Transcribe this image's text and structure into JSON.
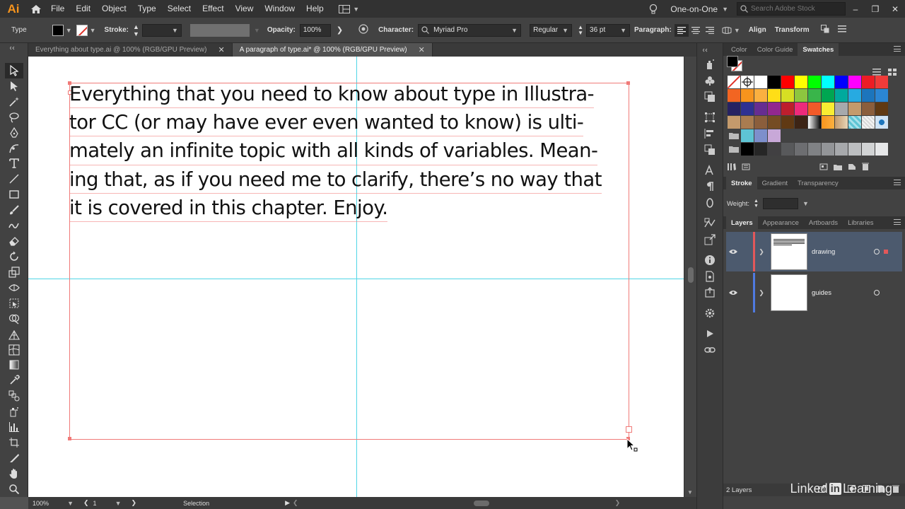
{
  "app": {
    "logo": "Ai",
    "menus": [
      "File",
      "Edit",
      "Object",
      "Type",
      "Select",
      "Effect",
      "View",
      "Window",
      "Help"
    ],
    "workspace": "One-on-One",
    "search_placeholder": "Search Adobe Stock"
  },
  "control_bar": {
    "tool_label": "Type",
    "stroke_label": "Stroke:",
    "opacity_label": "Opacity:",
    "opacity_value": "100%",
    "character_label": "Character:",
    "font_family": "Myriad Pro",
    "font_style": "Regular",
    "font_size": "36 pt",
    "paragraph_label": "Paragraph:",
    "align_link": "Align",
    "transform_link": "Transform"
  },
  "tabs": [
    {
      "label": "Everything about type.ai @ 100% (RGB/GPU Preview)",
      "active": false
    },
    {
      "label": "A paragraph of type.ai* @ 100% (RGB/GPU Preview)",
      "active": true
    }
  ],
  "canvas": {
    "lines": [
      "Everything that you need to know about type in Illustra-",
      "tor CC (or may have ever even wanted to know) is ulti-",
      "mately an infinite topic with all kinds of variables. Mean-",
      "ing that, as if you need me to clarify, there’s no way that",
      "it is covered in this chapter. Enjoy."
    ]
  },
  "status_bar": {
    "zoom": "100%",
    "artboard": "1",
    "tool": "Selection"
  },
  "panels": {
    "top_tabs": [
      "Color",
      "Color Guide",
      "Swatches"
    ],
    "active_top_tab": "Swatches",
    "stroke_tabs": [
      "Stroke",
      "Gradient",
      "Transparency"
    ],
    "weight_label": "Weight:",
    "layers_tabs": [
      "Layers",
      "Appearance",
      "Artboards",
      "Libraries"
    ],
    "layers": [
      {
        "name": "drawing",
        "color": "#e2585a",
        "selected": true
      },
      {
        "name": "guides",
        "color": "#4f7ae0",
        "selected": false
      }
    ],
    "layers_count": "2 Layers"
  },
  "swatches": {
    "rows": [
      [
        "none",
        "reg",
        "#ffffff",
        "#000000",
        "#ff0000",
        "#ffff00",
        "#00ff00",
        "#00ffff",
        "#0000ff",
        "#ff00ff",
        "#ed1c24",
        "#ef3b39"
      ],
      [
        "#f26522",
        "#f7941d",
        "#fbb040",
        "#ffde17",
        "#d7df23",
        "#8dc63f",
        "#39b54a",
        "#00a651",
        "#00a99d",
        "#27aae1",
        "#1c75bc",
        "#2b86d4"
      ],
      [
        "#262262",
        "#2e3192",
        "#662d91",
        "#92278f",
        "#be1e2d",
        "#ee2a7b",
        "#f15a29",
        "#f9ed32",
        "#a7a9ac",
        "#c49a6c",
        "#8b5e3c",
        "#603913"
      ],
      [
        "#c49a6c",
        "#a97c50",
        "#8b5e3c",
        "#754c24",
        "#603913",
        "#3c2415",
        "grad-bw",
        "grad-orange",
        "grad-tan",
        "pattern-blue",
        "pattern-white",
        "pattern-dots"
      ],
      [
        "folder",
        "#5ec4d4",
        "#7d8fcc",
        "#c8a8d8"
      ],
      [
        "folder",
        "#000000",
        "#262626",
        "#414042",
        "#58595b",
        "#6d6e71",
        "#808285",
        "#939598",
        "#a7a9ac",
        "#bcbec0",
        "#d1d3d4",
        "#e6e7e8"
      ]
    ]
  },
  "watermark": {
    "left": "Linked",
    "in": "in",
    "right": "Learning"
  }
}
